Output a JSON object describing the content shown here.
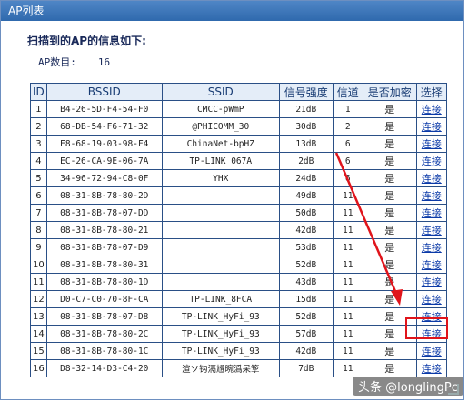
{
  "titlebar": {
    "title": "AP列表"
  },
  "heading": "扫描到的AP的信息如下:",
  "ap_count": {
    "label": "AP数目:",
    "value": "16"
  },
  "table": {
    "headers": [
      "ID",
      "BSSID",
      "SSID",
      "信号强度",
      "信道",
      "是否加密",
      "选择"
    ],
    "rows": [
      {
        "id": "1",
        "bssid": "B4-26-5D-F4-54-F0",
        "ssid": "CMCC-pWmP",
        "signal": "21dB",
        "channel": "1",
        "enc": "是",
        "action": "连接"
      },
      {
        "id": "2",
        "bssid": "68-DB-54-F6-71-32",
        "ssid": "@PHICOMM_30",
        "signal": "30dB",
        "channel": "2",
        "enc": "是",
        "action": "连接"
      },
      {
        "id": "3",
        "bssid": "E8-68-19-03-98-F4",
        "ssid": "ChinaNet-bpHZ",
        "signal": "13dB",
        "channel": "6",
        "enc": "是",
        "action": "连接"
      },
      {
        "id": "4",
        "bssid": "EC-26-CA-9E-06-7A",
        "ssid": "TP-LINK_067A",
        "signal": "2dB",
        "channel": "6",
        "enc": "是",
        "action": "连接"
      },
      {
        "id": "5",
        "bssid": "34-96-72-94-C8-0F",
        "ssid": "YHX",
        "signal": "24dB",
        "channel": "6",
        "enc": "是",
        "action": "连接"
      },
      {
        "id": "6",
        "bssid": "08-31-8B-78-80-2D",
        "ssid": "",
        "signal": "49dB",
        "channel": "11",
        "enc": "是",
        "action": "连接"
      },
      {
        "id": "7",
        "bssid": "08-31-8B-78-07-DD",
        "ssid": "",
        "signal": "50dB",
        "channel": "11",
        "enc": "是",
        "action": "连接"
      },
      {
        "id": "8",
        "bssid": "08-31-8B-78-80-21",
        "ssid": "",
        "signal": "42dB",
        "channel": "11",
        "enc": "是",
        "action": "连接"
      },
      {
        "id": "9",
        "bssid": "08-31-8B-78-07-D9",
        "ssid": "",
        "signal": "53dB",
        "channel": "11",
        "enc": "是",
        "action": "连接"
      },
      {
        "id": "10",
        "bssid": "08-31-8B-78-80-31",
        "ssid": "",
        "signal": "52dB",
        "channel": "11",
        "enc": "是",
        "action": "连接"
      },
      {
        "id": "11",
        "bssid": "08-31-8B-78-80-1D",
        "ssid": "",
        "signal": "43dB",
        "channel": "11",
        "enc": "是",
        "action": "连接"
      },
      {
        "id": "12",
        "bssid": "D0-C7-C0-70-8F-CA",
        "ssid": "TP-LINK_8FCA",
        "signal": "15dB",
        "channel": "11",
        "enc": "是",
        "action": "连接"
      },
      {
        "id": "13",
        "bssid": "08-31-8B-78-07-D8",
        "ssid": "TP-LINK_HyFi_93",
        "signal": "52dB",
        "channel": "11",
        "enc": "是",
        "action": "连接"
      },
      {
        "id": "14",
        "bssid": "08-31-8B-78-80-2C",
        "ssid": "TP-LINK_HyFi_93",
        "signal": "57dB",
        "channel": "11",
        "enc": "是",
        "action": "连接"
      },
      {
        "id": "15",
        "bssid": "08-31-8B-78-80-1C",
        "ssid": "TP-LINK_HyFi_93",
        "signal": "42dB",
        "channel": "11",
        "enc": "是",
        "action": "连接"
      },
      {
        "id": "16",
        "bssid": "D8-32-14-D3-C4-20",
        "ssid": "渲ソ钩滆尳晼潙呆箰",
        "signal": "7dB",
        "channel": "11",
        "enc": "是",
        "action": "连接"
      }
    ]
  },
  "watermark": "头条 @longlingPc",
  "colors": {
    "titlebar": "#3a74b8",
    "table_border": "#2a4f86",
    "header_bg": "#e4edf8",
    "link": "#0b3aa8",
    "annotation_red": "#e0141b"
  }
}
